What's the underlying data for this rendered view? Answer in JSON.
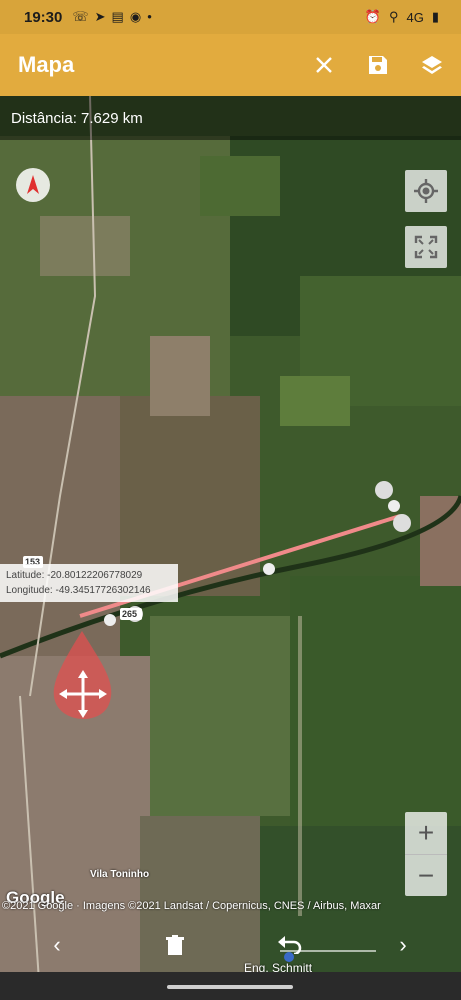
{
  "status_bar": {
    "time": "19:30",
    "notification_icons": [
      "whatsapp-icon",
      "telegram-icon",
      "news-icon",
      "facebook-icon",
      "dot-icon"
    ],
    "status_icons": [
      "alarm-icon",
      "location-icon",
      "signal-4g-icon",
      "battery-icon"
    ],
    "network_label": "4G"
  },
  "app_bar": {
    "title": "Mapa",
    "background_color": "#e2ab3e",
    "actions": [
      "close-icon",
      "save-icon",
      "layers-icon"
    ]
  },
  "map": {
    "distance_label": "Distância: 7.629 km",
    "coordinates": {
      "latitude": "Latitude: -20.80122206778029",
      "longitude": "Longitude: -49.34517726302146"
    },
    "place_labels": [
      "Vila Toninho",
      "Eng. Schmitt"
    ],
    "road_shield": "153",
    "road_shield_2": "265",
    "logo": "Google",
    "copyright": "©2021 Google · Imagens ©2021 Landsat / Copernicus, CNES / Airbus, Maxar",
    "zoom_in": "+",
    "zoom_out": "−",
    "route_color": "#f08a8a"
  },
  "bottom_controls": {
    "prev": "‹",
    "next": "›",
    "slider_value": 0.05
  }
}
